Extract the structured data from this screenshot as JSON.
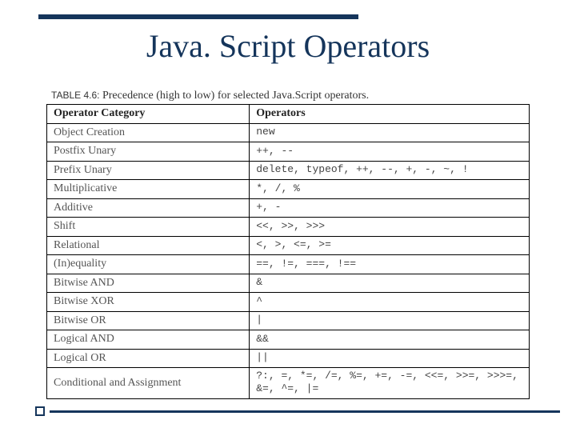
{
  "title": "Java. Script Operators",
  "table_caption_label": "TABLE 4.6:",
  "table_caption_text": "Precedence (high to low) for selected Java.Script operators.",
  "headers": {
    "category": "Operator Category",
    "operators": "Operators"
  },
  "rows": [
    {
      "category": "Object Creation",
      "operators": "new"
    },
    {
      "category": "Postfix Unary",
      "operators": "++, --"
    },
    {
      "category": "Prefix Unary",
      "operators": "delete, typeof, ++, --, +, -, ~, !"
    },
    {
      "category": "Multiplicative",
      "operators": "*, /, %"
    },
    {
      "category": "Additive",
      "operators": "+, -"
    },
    {
      "category": "Shift",
      "operators": "<<, >>, >>>"
    },
    {
      "category": "Relational",
      "operators": "<, >, <=, >="
    },
    {
      "category": "(In)equality",
      "operators": "==, !=, ===, !=="
    },
    {
      "category": "Bitwise AND",
      "operators": "&"
    },
    {
      "category": "Bitwise XOR",
      "operators": "^"
    },
    {
      "category": "Bitwise OR",
      "operators": "|"
    },
    {
      "category": "Logical AND",
      "operators": "&&"
    },
    {
      "category": "Logical OR",
      "operators": "||"
    },
    {
      "category": "Conditional and Assignment",
      "operators": "?:, =, *=, /=, %=, +=, -=, <<=, >>=, >>>=, &=, ^=, |="
    }
  ]
}
